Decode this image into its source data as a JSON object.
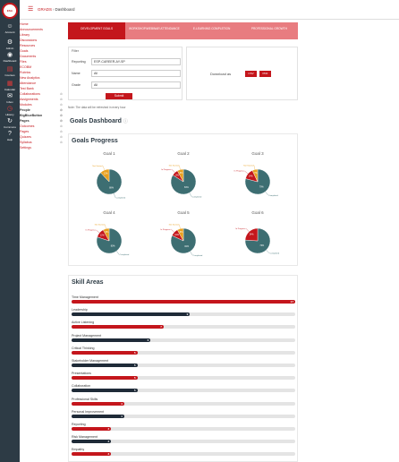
{
  "logo": {
    "text": "ESA"
  },
  "global_nav": [
    {
      "label": "Account",
      "icon": "user-icon",
      "glyph": "☺"
    },
    {
      "label": "Admin",
      "icon": "shield-icon",
      "glyph": "⚙"
    },
    {
      "label": "Dashboard",
      "icon": "dashboard-icon",
      "glyph": "◉"
    },
    {
      "label": "Courses",
      "icon": "book-icon",
      "glyph": "▤"
    },
    {
      "label": "Calendar",
      "icon": "calendar-icon",
      "glyph": "▦"
    },
    {
      "label": "Inbox",
      "icon": "inbox-icon",
      "glyph": "✉"
    },
    {
      "label": "History",
      "icon": "clock-icon",
      "glyph": "◷"
    },
    {
      "label": "Commons",
      "icon": "commons-icon",
      "glyph": "↻"
    },
    {
      "label": "Help",
      "icon": "help-icon",
      "glyph": "?"
    }
  ],
  "header": {
    "course": "GRADS",
    "page": "Dashboard"
  },
  "course_nav": [
    "Home",
    "Announcements",
    "Library",
    "Discussions",
    "Resources",
    "Goals",
    "Documents",
    "Files",
    "ECOBM",
    "Rubrics",
    "New Analytics",
    "Attendance",
    "Test Bank",
    "Collaborations",
    "Assignments",
    "Modules",
    "People",
    "BigBlueButton",
    "Pages",
    "Outcomes",
    "Pages",
    "Quizzes",
    "Syllabus",
    "Settings"
  ],
  "tabs": [
    {
      "label": "DEVELOPMENT GOALS",
      "active": true
    },
    {
      "label": "WORKSHOP/WEBINAR ATTENDANCE",
      "active": false
    },
    {
      "label": "E-LEARNING COMPLETION",
      "active": false
    },
    {
      "label": "PROFESSIONAL GROWTH",
      "active": false
    }
  ],
  "filter": {
    "title": "Filter",
    "fields": [
      {
        "label": "Reporting",
        "value": "ESP-CAREER-AY-SP"
      },
      {
        "label": "Name",
        "value": "All"
      },
      {
        "label": "Grade",
        "value": "All"
      }
    ],
    "submit": "Submit"
  },
  "download": {
    "label": "Download as",
    "csv": "CSV",
    "pdf": "PDF"
  },
  "note": "Note: The data will be refreshed in every hour",
  "dashboard_title": "Goals Dashboard",
  "goals_title": "Goals Progress",
  "skills_title": "Skill Areas",
  "chart_data": [
    {
      "type": "pie",
      "title": "Goal 1",
      "slices": [
        {
          "label": "Completed",
          "value": 88,
          "color": "#3d6e72"
        },
        {
          "label": "Not Started",
          "value": 12,
          "color": "#e8a020"
        }
      ]
    },
    {
      "type": "pie",
      "title": "Goal 2",
      "slices": [
        {
          "label": "Completed",
          "value": 84,
          "color": "#3d6e72"
        },
        {
          "label": "In Progress",
          "value": 8,
          "color": "#c4161c"
        },
        {
          "label": "Not Started",
          "value": 8,
          "color": "#e8a020"
        }
      ]
    },
    {
      "type": "pie",
      "title": "Goal 3",
      "slices": [
        {
          "label": "Completed",
          "value": 79,
          "color": "#3d6e72"
        },
        {
          "label": "In Progress",
          "value": 14,
          "color": "#c4161c"
        },
        {
          "label": "Not Started",
          "value": 7,
          "color": "#e8a020"
        }
      ]
    },
    {
      "type": "pie",
      "title": "Goal 4",
      "slices": [
        {
          "label": "Completed",
          "value": 80,
          "color": "#3d6e72"
        },
        {
          "label": "In Progress",
          "value": 12,
          "color": "#c4161c"
        },
        {
          "label": "Not Started",
          "value": 8,
          "color": "#e8a020"
        }
      ]
    },
    {
      "type": "pie",
      "title": "Goal 5",
      "slices": [
        {
          "label": "Completed",
          "value": 82,
          "color": "#3d6e72"
        },
        {
          "label": "In Progress",
          "value": 10,
          "color": "#c4161c"
        },
        {
          "label": "Not Started",
          "value": 8,
          "color": "#e8a020"
        }
      ]
    },
    {
      "type": "pie",
      "title": "Goal 6",
      "slices": [
        {
          "label": "Completed",
          "value": 76,
          "color": "#3d6e72"
        },
        {
          "label": "In Progress",
          "value": 24,
          "color": "#c4161c"
        }
      ]
    },
    {
      "type": "bar",
      "title": "Skill Areas",
      "max": 17,
      "categories": [
        "Time Management",
        "Leadership",
        "Active Listening",
        "Project Management",
        "Critical Thinking",
        "Stakeholder Management",
        "Presentations",
        "Collaboration",
        "Professional Skills",
        "Personal Improvement",
        "Reporting",
        "Risk Management",
        "Empathy"
      ],
      "values": [
        17,
        9,
        7,
        6,
        5,
        5,
        5,
        5,
        4,
        4,
        3,
        3,
        3
      ],
      "colors": [
        "#c4161c",
        "#1f2b38",
        "#c4161c",
        "#1f2b38",
        "#c4161c",
        "#1f2b38",
        "#c4161c",
        "#1f2b38",
        "#c4161c",
        "#1f2b38",
        "#c4161c",
        "#1f2b38",
        "#c4161c"
      ]
    }
  ]
}
